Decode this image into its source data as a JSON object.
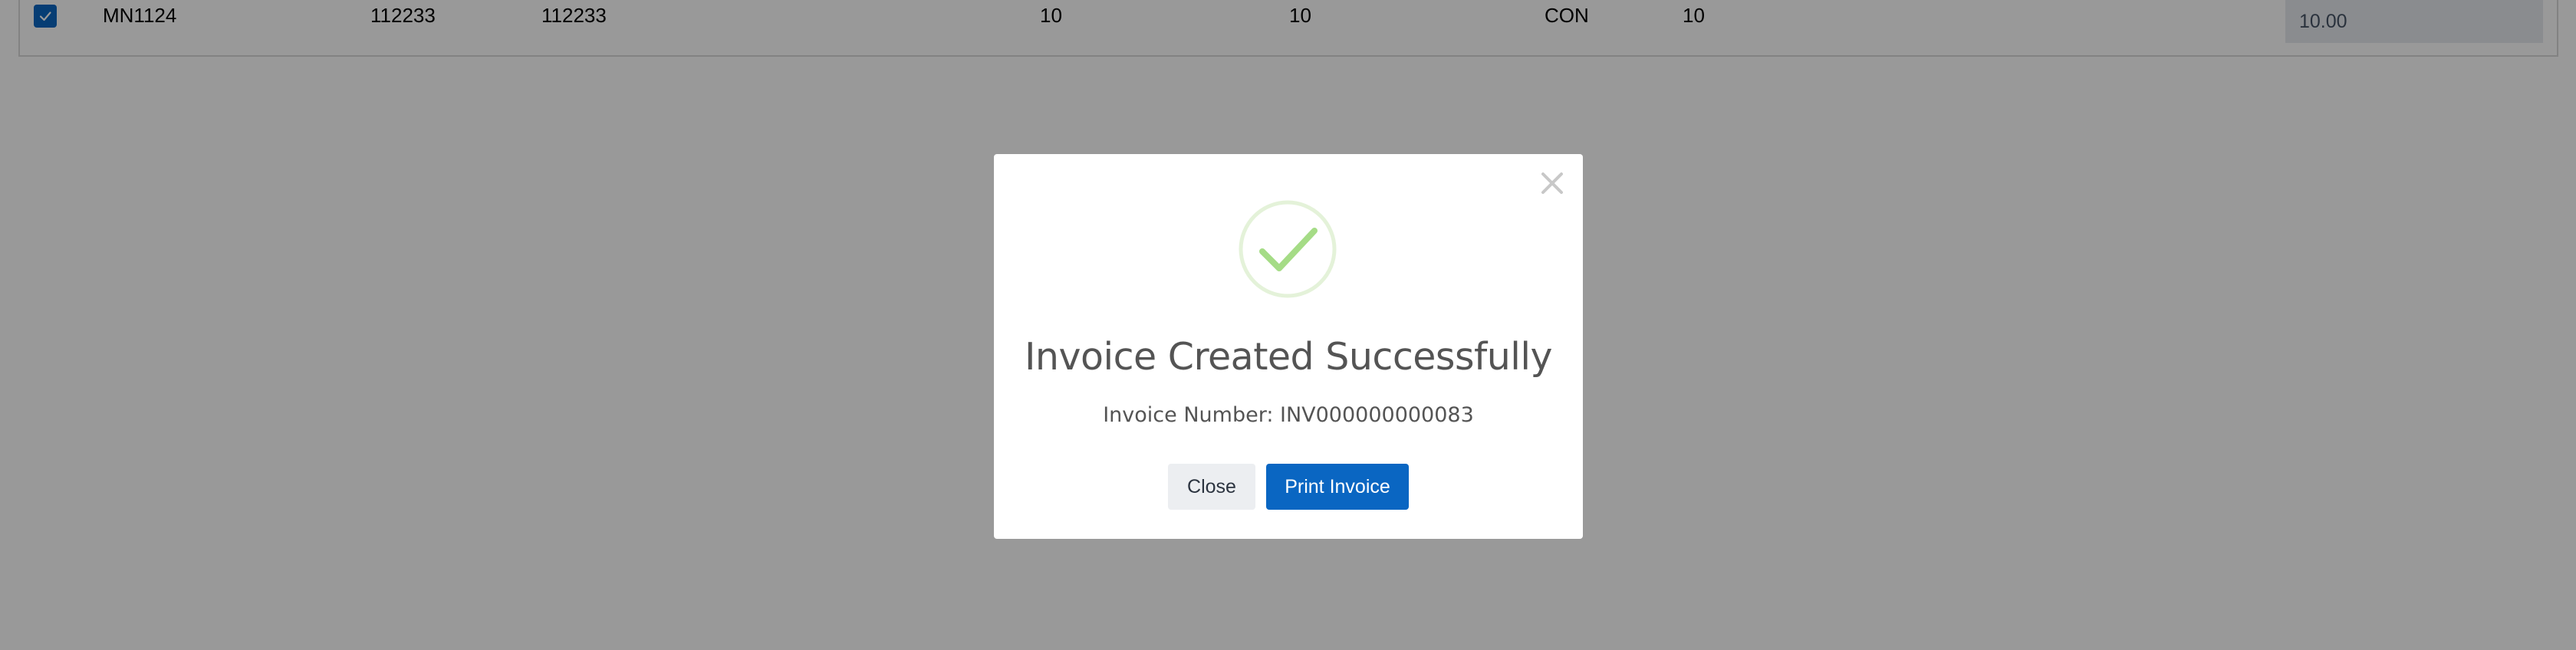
{
  "table": {
    "row": {
      "checked": true,
      "code": "MN1124",
      "col2": "112233",
      "col3": "112233",
      "col4": "10",
      "col5": "10",
      "unit": "CON",
      "col7": "10",
      "input_value": "10.00"
    }
  },
  "modal": {
    "title": "Invoice Created Successfully",
    "message": "Invoice Number: INV000000000083",
    "close_label": "Close",
    "print_label": "Print Invoice",
    "icons": {
      "dismiss": "close-icon",
      "status": "success-check-icon"
    }
  },
  "colors": {
    "primary": "#0a66c2",
    "success": "#a5dc86",
    "overlay": "rgba(0,0,0,0.4)",
    "text": "#545454"
  }
}
